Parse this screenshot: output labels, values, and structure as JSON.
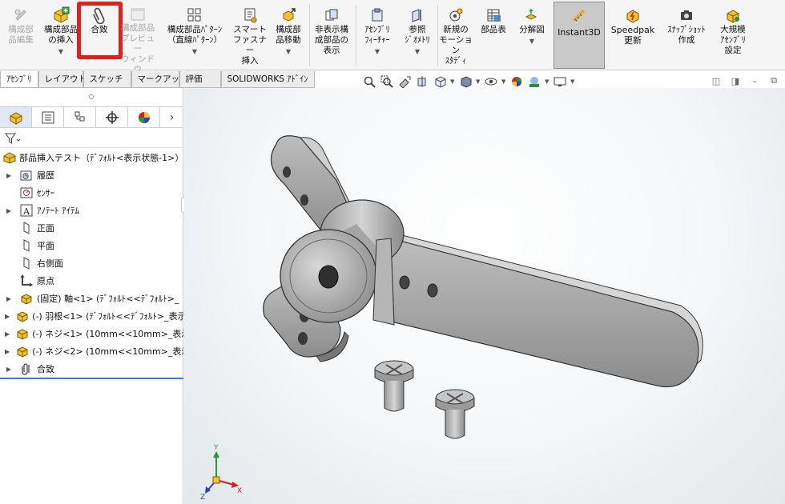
{
  "ribbon": {
    "buttons": [
      {
        "id": "edit-component",
        "label": "構成部\n品編集",
        "disabled": true
      },
      {
        "id": "insert-component",
        "label": "構成部品\nの挿入"
      },
      {
        "id": "mate",
        "label": "合致"
      },
      {
        "id": "component-preview",
        "label": "構成部品\nプレビュー\nウィンドウ",
        "disabled": true
      },
      {
        "id": "linear-pattern",
        "label": "構成部品ﾊﾟﾀｰﾝ\n（直線ﾊﾟﾀｰﾝ）"
      },
      {
        "id": "smart-fasteners",
        "label": "スマート\nファスナー\n挿入"
      },
      {
        "id": "move-component",
        "label": "構成部\n品移動"
      },
      {
        "id": "show-hidden",
        "label": "非表示構\n成部品の\n表示"
      },
      {
        "id": "assembly-features",
        "label": "ｱｾﾝﾌﾞﾘ\nﾌｨｰﾁｬｰ"
      },
      {
        "id": "reference-geometry",
        "label": "参照\nｼﾞｵﾒﾄﾘ"
      },
      {
        "id": "new-motion-study",
        "label": "新規の\nモーション\nｽﾀﾃﾞｨ"
      },
      {
        "id": "bom",
        "label": "部品表"
      },
      {
        "id": "exploded-view",
        "label": "分解図"
      },
      {
        "id": "instant3d",
        "label": "Instant3D"
      },
      {
        "id": "speedpak",
        "label": "Speedpak\n更新"
      },
      {
        "id": "snapshot",
        "label": "ｽﾅｯﾌﾟｼｮｯﾄ\n作成"
      },
      {
        "id": "large-assembly",
        "label": "大規模\nｱｾﾝﾌﾞﾘ\n設定"
      }
    ]
  },
  "tabs": [
    "ｱｾﾝﾌﾞﾘ",
    "レイアウト",
    "スケッチ",
    "マークアップ",
    "評価",
    "SOLIDWORKS ｱﾄﾞｲﾝ"
  ],
  "active_tab": 0,
  "tree": {
    "root": "部品挿入テスト（ﾃﾞﾌｫﾙﾄ<表示状態-1>）",
    "items": [
      {
        "label": "履歴",
        "icon": "history-icon",
        "expand": true
      },
      {
        "label": "ｾﾝｻｰ",
        "icon": "sensor-icon",
        "expand": false
      },
      {
        "label": "ｱﾉﾃｰﾄ ｱｲﾃﾑ",
        "icon": "annotation-icon",
        "expand": true
      },
      {
        "label": "正面",
        "icon": "plane-icon",
        "expand": false
      },
      {
        "label": "平面",
        "icon": "plane-icon",
        "expand": false
      },
      {
        "label": "右側面",
        "icon": "plane-icon",
        "expand": false
      },
      {
        "label": "原点",
        "icon": "origin-icon",
        "expand": false
      },
      {
        "label": "(固定) 軸<1> (ﾃﾞﾌｫﾙﾄ<<ﾃﾞﾌｫﾙﾄ>_",
        "icon": "part-icon",
        "expand": true
      },
      {
        "label": "(-) 羽根<1> (ﾃﾞﾌｫﾙﾄ<<ﾃﾞﾌｫﾙﾄ>_表示",
        "icon": "part-icon",
        "expand": true
      },
      {
        "label": "(-) ネジ<1> (10mm<<10mm>_表示",
        "icon": "part-icon",
        "expand": true
      },
      {
        "label": "(-) ネジ<2> (10mm<<10mm>_表示",
        "icon": "part-icon",
        "expand": true
      },
      {
        "label": "合致",
        "icon": "mates-icon",
        "expand": true
      }
    ]
  },
  "triad": {
    "x": "X",
    "y": "Y",
    "z": "Z"
  },
  "colors": {
    "highlight": "#e0201b",
    "selection": "#3a7bd5",
    "axis_x": "#d42020",
    "axis_y": "#1f9d2e",
    "axis_z": "#2a3fd0"
  }
}
